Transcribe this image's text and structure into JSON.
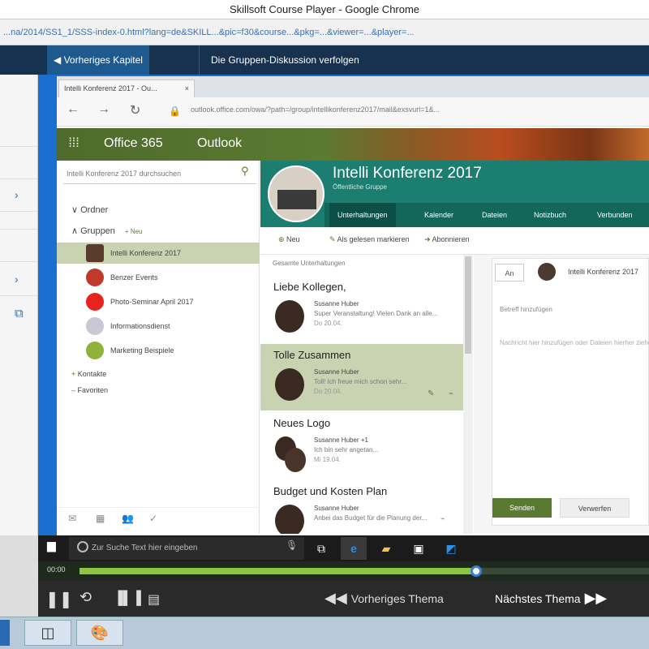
{
  "window": {
    "title": "Skillsoft Course Player - Google Chrome"
  },
  "address": {
    "url": "...na/2014/SS1_1/SSS-index-0.html?lang=de&SKILL...&pic=f30&course...&pkg=...&viewer=...&player=..."
  },
  "course": {
    "prev_chapter": "Vorheriges Kapitel",
    "chapter_title": "Die Gruppen-Diskussion verfolgen"
  },
  "browser": {
    "tab_title": "Intelli Konferenz 2017 - Ou...",
    "tab_close": "×",
    "inner_url": "outlook.office.com/owa/?path=/group/intellikonferenz2017/mail&exsvurl=1&..."
  },
  "o365": {
    "brand": "Office 365",
    "app": "Outlook"
  },
  "nav": {
    "search_placeholder": "Intelli Konferenz 2017 durchsuchen",
    "ordner": "Ordner",
    "gruppen": "Gruppen",
    "neu": "+ Neu",
    "groups": [
      {
        "name": "Intelli Konferenz 2017"
      },
      {
        "name": "Benzer Events"
      },
      {
        "name": "Photo-Seminar April 2017"
      },
      {
        "name": "Informationsdienst"
      },
      {
        "name": "Marketing Beispiele"
      }
    ],
    "kontakte": "Kontakte",
    "favoriten": "Favoriten"
  },
  "group": {
    "name": "Intelli Konferenz 2017",
    "subtitle": "Öffentliche Gruppe",
    "tabs": [
      "Unterhaltungen",
      "Kalender",
      "Dateien",
      "Notizbuch",
      "Verbunden"
    ]
  },
  "commands": {
    "new": "Neu",
    "read_all": "Als gelesen markieren",
    "subscribe": "Abonnieren"
  },
  "list": {
    "heading": "Gesamte Unterhaltungen",
    "items": [
      {
        "subject": "Liebe Kollegen,",
        "from": "Susanne Huber",
        "preview": "Super Veranstaltung! Vielen Dank an alle...",
        "date": "Do 20.04."
      },
      {
        "subject": "Tolle Zusammen",
        "from": "Susanne Huber",
        "preview": "Toll! Ich freue mich schon sehr...",
        "date": "Do 20.04."
      },
      {
        "subject": "Neues Logo",
        "from": "Susanne Huber +1",
        "preview": "Ich bin sehr angetan...",
        "date": "Mi 19.04."
      },
      {
        "subject": "Budget und Kosten Plan",
        "from": "Susanne Huber",
        "preview": "Anbei das Budget für die Planung der...",
        "date": "Mi 19.04."
      }
    ]
  },
  "compose": {
    "to_label": "An",
    "to_name": "Intelli Konferenz 2017",
    "subject_placeholder": "Betreff hinzufügen",
    "body_placeholder": "Nachricht hier hinzufügen oder Dateien hierher ziehen",
    "send": "Senden",
    "discard": "Verwerfen"
  },
  "taskbar": {
    "search_placeholder": "Zur Suche Text hier eingeben"
  },
  "player": {
    "time_label": "00:00",
    "progress": 0.697,
    "prev_topic": "Vorheriges Thema",
    "next_topic": "Nächstes Thema"
  },
  "colors": {
    "accent": "#1c7e70",
    "olive": "#5b7a31",
    "progress": "#8cc63f"
  }
}
